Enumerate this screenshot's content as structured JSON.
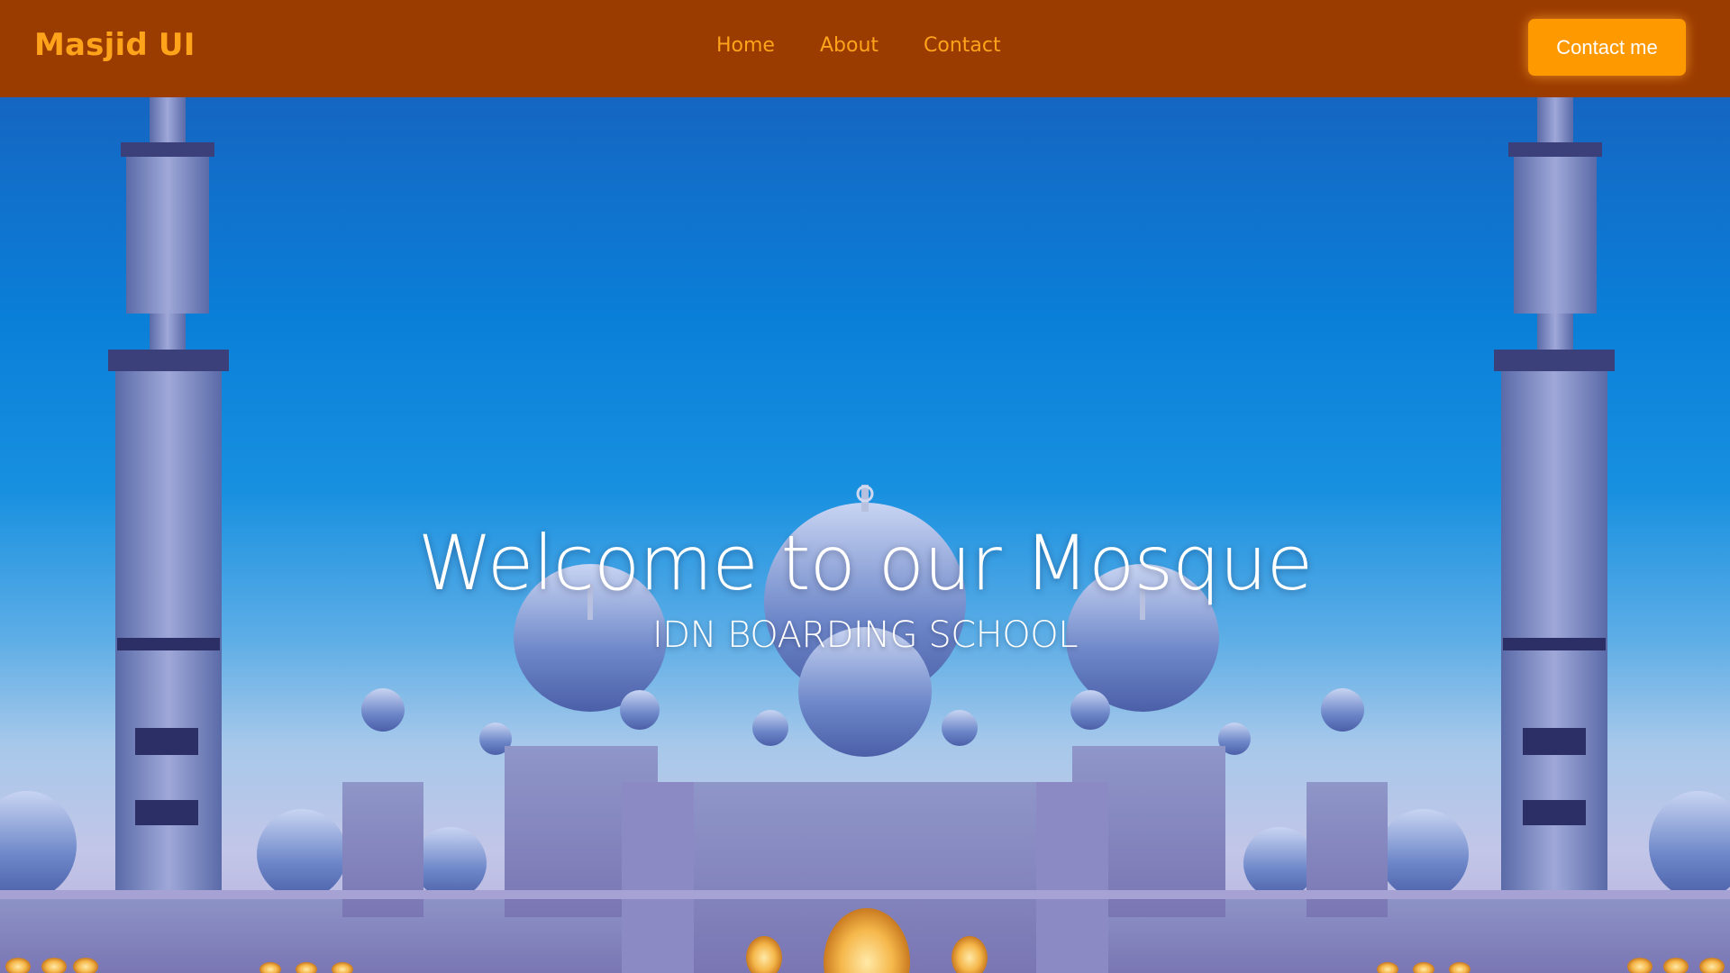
{
  "navbar": {
    "brand": "Masjid UI",
    "links": [
      {
        "label": "Home"
      },
      {
        "label": "About"
      },
      {
        "label": "Contact"
      }
    ],
    "cta_label": "Contact me"
  },
  "hero": {
    "title": "Welcome to our Mosque",
    "subtitle": "IDN BOARDING SCHOOL"
  },
  "colors": {
    "navbar_bg": "#9a3b00",
    "brand_text": "#ffa31a",
    "cta_bg": "#ff9900",
    "hero_text": "#ffffff",
    "sky_blue": "#0a7fd8"
  }
}
